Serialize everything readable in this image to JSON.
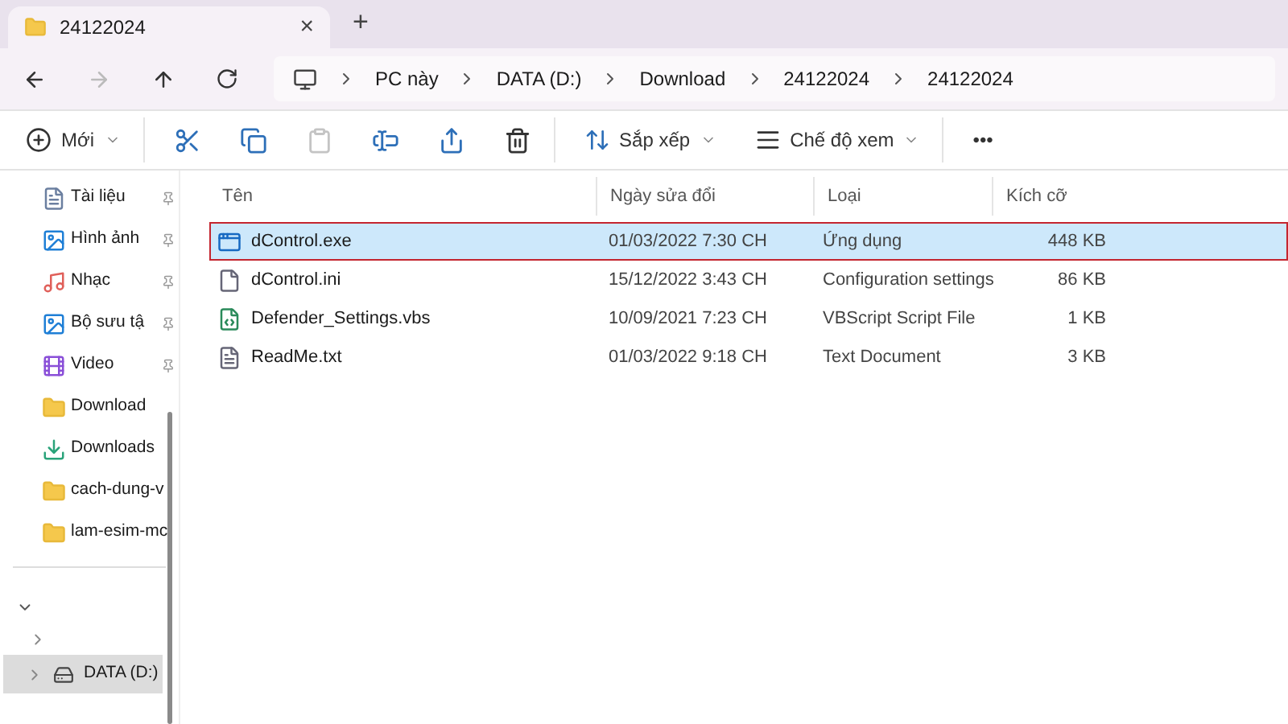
{
  "tab": {
    "title": "24122024",
    "close": "×",
    "new": "+"
  },
  "breadcrumb": [
    "PC này",
    "DATA (D:)",
    "Download",
    "24122024",
    "24122024"
  ],
  "toolbar": [
    {
      "kind": "new",
      "label": "Mới"
    },
    {
      "kind": "cut"
    },
    {
      "kind": "copy"
    },
    {
      "kind": "paste",
      "disabled": true
    },
    {
      "kind": "rename"
    },
    {
      "kind": "share"
    },
    {
      "kind": "delete"
    },
    {
      "kind": "sort",
      "label": "Sắp xếp"
    },
    {
      "kind": "view",
      "label": "Chế độ xem"
    },
    {
      "kind": "more",
      "label": "•••"
    }
  ],
  "sidebar": {
    "items": [
      {
        "label": "Tài liệu",
        "kind": "docs",
        "pinned": true
      },
      {
        "label": "Hình ảnh",
        "kind": "pictures",
        "pinned": true
      },
      {
        "label": "Nhạc",
        "kind": "music",
        "pinned": true
      },
      {
        "label": "Bộ sưu tậ",
        "kind": "pictures",
        "pinned": true
      },
      {
        "label": "Video",
        "kind": "video",
        "pinned": true
      },
      {
        "label": "Download",
        "kind": "folder",
        "pinned": false
      },
      {
        "label": "Downloads",
        "kind": "download",
        "pinned": false
      },
      {
        "label": "cach-dung-v",
        "kind": "folder",
        "pinned": false
      },
      {
        "label": "lam-esim-mc",
        "kind": "folder",
        "pinned": false
      }
    ],
    "tree": [
      {
        "label": "DATA (D:)",
        "selected": true
      }
    ]
  },
  "table": {
    "columns": [
      "Tên",
      "Ngày sửa đổi",
      "Loại",
      "Kích cỡ"
    ],
    "rows": [
      {
        "kind": "exe",
        "name": "dControl.exe",
        "modified": "01/03/2022 7:30 CH",
        "type": "Ứng dụng",
        "size": "448 KB",
        "selected": true
      },
      {
        "kind": "ini",
        "name": "dControl.ini",
        "modified": "15/12/2022 3:43 CH",
        "type": "Configuration settings",
        "size": "86 KB",
        "selected": false
      },
      {
        "kind": "vbs",
        "name": "Defender_Settings.vbs",
        "modified": "10/09/2021 7:23 CH",
        "type": "VBScript Script File",
        "size": "1 KB",
        "selected": false
      },
      {
        "kind": "txt",
        "name": "ReadMe.txt",
        "modified": "01/03/2022 9:18 CH",
        "type": "Text Document",
        "size": "3 KB",
        "selected": false
      }
    ]
  }
}
